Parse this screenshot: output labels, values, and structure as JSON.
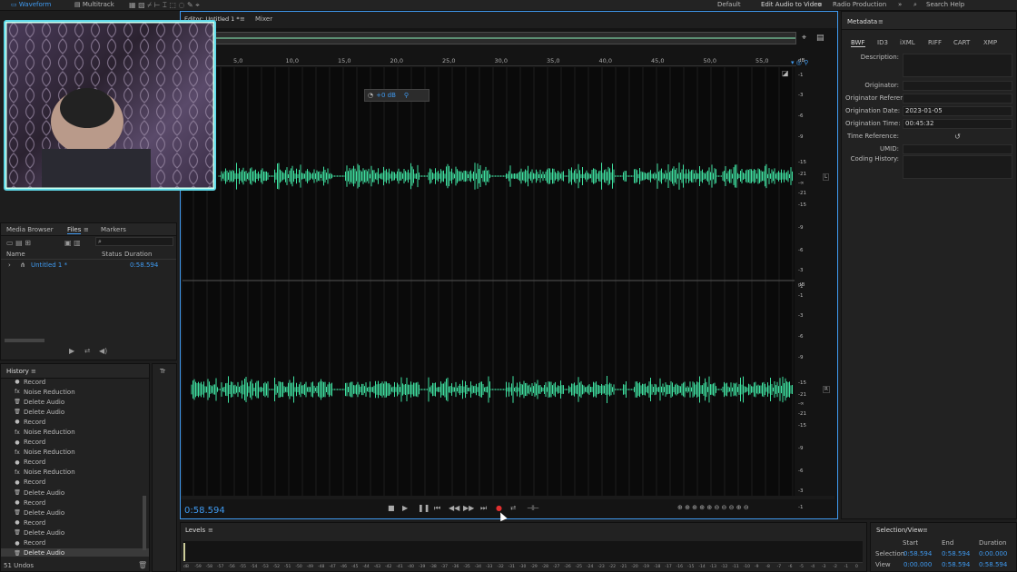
{
  "topbar": {
    "waveform_label": "Waveform",
    "multitrack_label": "Multitrack",
    "workspace_default": "Default",
    "workspace_edit_video": "Edit Audio to Video",
    "workspace_radio": "Radio Production",
    "search_placeholder": "Search Help"
  },
  "editor": {
    "tab_label": "Editor: Untitled 1 *",
    "mixer_tab": "Mixer",
    "time_display": "0:58.594",
    "hud_value": "+0 dB",
    "db_unit": "dB",
    "channel_l": "L",
    "channel_r": "R",
    "ruler_ticks": [
      "5,0",
      "10,0",
      "15,0",
      "20,0",
      "25,0",
      "30,0",
      "35,0",
      "40,0",
      "45,0",
      "50,0",
      "55,0"
    ],
    "db_scale_top": [
      "-1",
      "-3",
      "-6",
      "-9",
      "-15",
      "-21",
      "-∞",
      "-21",
      "-15",
      "-9",
      "-6",
      "-3",
      "-1"
    ],
    "db_scale_bottom": [
      "-1",
      "-3",
      "-6",
      "-9",
      "-15",
      "-21",
      "-∞",
      "-21",
      "-15",
      "-9",
      "-6",
      "-3",
      "-1"
    ]
  },
  "files_panel": {
    "tabs": [
      "Media Browser",
      "Files",
      "Markers"
    ],
    "columns": [
      "Name",
      "Status",
      "Duration"
    ],
    "rows": [
      {
        "name": "Untitled 1 *",
        "duration": "0:58.594"
      }
    ]
  },
  "history": {
    "title": "History",
    "side_tab": "Tr",
    "items": [
      "Record",
      "Noise Reduction",
      "Delete Audio",
      "Delete Audio",
      "Record",
      "Noise Reduction",
      "Record",
      "Noise Reduction",
      "Record",
      "Noise Reduction",
      "Record",
      "Delete Audio",
      "Record",
      "Delete Audio",
      "Record",
      "Delete Audio",
      "Record",
      "Delete Audio"
    ],
    "undo_count": "51 Undos"
  },
  "levels": {
    "title": "Levels",
    "scale": [
      "dB",
      "-59",
      "-58",
      "-57",
      "-56",
      "-55",
      "-54",
      "-53",
      "-52",
      "-51",
      "-50",
      "-49",
      "-48",
      "-47",
      "-46",
      "-45",
      "-44",
      "-43",
      "-42",
      "-41",
      "-40",
      "-39",
      "-38",
      "-37",
      "-36",
      "-35",
      "-34",
      "-33",
      "-32",
      "-31",
      "-30",
      "-29",
      "-28",
      "-27",
      "-26",
      "-25",
      "-24",
      "-23",
      "-22",
      "-21",
      "-20",
      "-19",
      "-18",
      "-17",
      "-16",
      "-15",
      "-14",
      "-13",
      "-12",
      "-11",
      "-10",
      "-9",
      "-8",
      "-7",
      "-6",
      "-5",
      "-4",
      "-3",
      "-2",
      "-1",
      "0"
    ]
  },
  "metadata": {
    "title": "Metadata",
    "tabs": [
      "BWF",
      "ID3",
      "iXML",
      "RIFF",
      "CART",
      "XMP"
    ],
    "fields": {
      "description": "Description:",
      "originator": "Originator:",
      "originator_reference": "Originator Reference:",
      "origination_date": "Origination Date:",
      "origination_date_value": "2023-01-05",
      "origination_time": "Origination Time:",
      "origination_time_value": "00:45:32",
      "time_reference": "Time Reference:",
      "umid": "UMID:",
      "coding_history": "Coding History:"
    }
  },
  "selection_view": {
    "title": "Selection/View",
    "headers": [
      "Start",
      "End",
      "Duration"
    ],
    "selection": {
      "label": "Selection",
      "start": "0:58.594",
      "end": "0:58.594",
      "duration": "0:00.000"
    },
    "view": {
      "label": "View",
      "start": "0:00.000",
      "end": "0:58.594",
      "duration": "0:58.594"
    }
  },
  "colors": {
    "waveform": "#3fe0a0",
    "accent": "#3f9af0",
    "record": "#e03030"
  }
}
